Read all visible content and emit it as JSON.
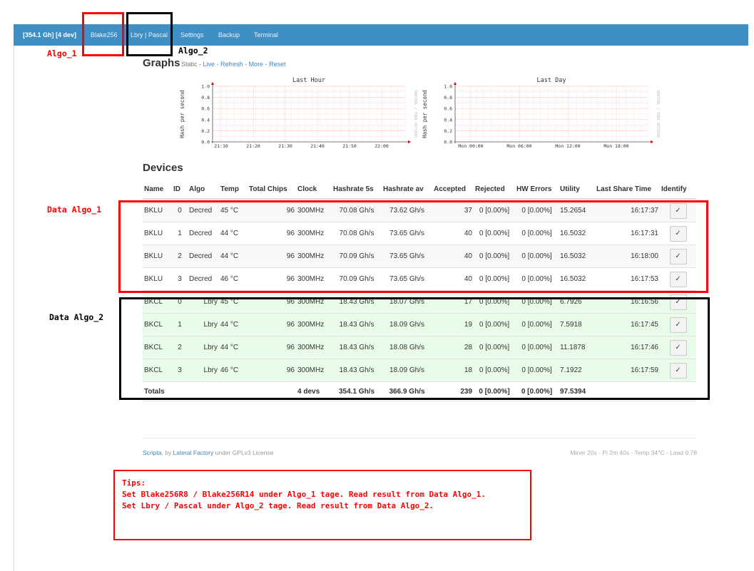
{
  "navbar": {
    "brand": "[354.1 Gh] [4 dev]",
    "items": [
      "Blake256",
      "Lbry | Pascal",
      "Settings",
      "Backup",
      "Terminal"
    ]
  },
  "annotations": {
    "algo1": "Algo_1",
    "algo2": "Algo_2",
    "data_algo1": "Data Algo_1",
    "data_algo2": "Data Algo_2"
  },
  "graphs": {
    "heading": "Graphs",
    "static_label": "Static -",
    "links": [
      "Live",
      "Refresh",
      "More",
      "Reset"
    ],
    "charts": [
      {
        "title": "Last Hour",
        "ylabel": "Hash per second",
        "right_label": "RRDTOOL / TOBI OETIKER",
        "yticks": [
          "1.0",
          "0.8",
          "0.6",
          "0.4",
          "0.2",
          "0.0"
        ],
        "xticks": [
          "21:10",
          "21:20",
          "21:30",
          "21:40",
          "21:50",
          "22:00"
        ]
      },
      {
        "title": "Last Day",
        "ylabel": "Hash per second",
        "right_label": "RRDTOOL / TOBI OETIKER",
        "yticks": [
          "1.0",
          "0.8",
          "0.6",
          "0.4",
          "0.2",
          "0.0"
        ],
        "xticks": [
          "Mon 00:00",
          "Mon 06:00",
          "Mon 12:00",
          "Mon 18:00"
        ]
      }
    ]
  },
  "devices": {
    "heading": "Devices",
    "columns": [
      "Name",
      "ID",
      "Algo",
      "Temp",
      "Total Chips",
      "Clock",
      "Hashrate 5s",
      "Hashrate av",
      "Accepted",
      "Rejected",
      "HW Errors",
      "Utility",
      "Last Share Time",
      "Identify"
    ],
    "identify_glyph": "✓",
    "rows": [
      {
        "group": "a1",
        "cells": [
          "BKLU",
          "0",
          "Decred",
          "45 °C",
          "96",
          "300MHz",
          "70.08 Gh/s",
          "73.62 Gh/s",
          "37",
          "0 [0.00%]",
          "0 [0.00%]",
          "15.2654",
          "16:17:37"
        ]
      },
      {
        "group": "a1",
        "cells": [
          "BKLU",
          "1",
          "Decred",
          "44 °C",
          "96",
          "300MHz",
          "70.08 Gh/s",
          "73.65 Gh/s",
          "40",
          "0 [0.00%]",
          "0 [0.00%]",
          "16.5032",
          "16:17:31"
        ]
      },
      {
        "group": "a1",
        "cells": [
          "BKLU",
          "2",
          "Decred",
          "44 °C",
          "96",
          "300MHz",
          "70.09 Gh/s",
          "73.65 Gh/s",
          "40",
          "0 [0.00%]",
          "0 [0.00%]",
          "16.5032",
          "16:18:00"
        ]
      },
      {
        "group": "a1",
        "cells": [
          "BKLU",
          "3",
          "Decred",
          "46 °C",
          "96",
          "300MHz",
          "70.09 Gh/s",
          "73.65 Gh/s",
          "40",
          "0 [0.00%]",
          "0 [0.00%]",
          "16.5032",
          "16:17:53"
        ]
      },
      {
        "group": "a2",
        "cells": [
          "BKCL",
          "0",
          "Lbry",
          "45 °C",
          "96",
          "300MHz",
          "18.43 Gh/s",
          "18.07 Gh/s",
          "17",
          "0 [0.00%]",
          "0 [0.00%]",
          "6.7926",
          "16:16:56"
        ]
      },
      {
        "group": "a2",
        "cells": [
          "BKCL",
          "1",
          "Lbry",
          "44 °C",
          "96",
          "300MHz",
          "18.43 Gh/s",
          "18.09 Gh/s",
          "19",
          "0 [0.00%]",
          "0 [0.00%]",
          "7.5918",
          "16:17:45"
        ]
      },
      {
        "group": "a2",
        "cells": [
          "BKCL",
          "2",
          "Lbry",
          "44 °C",
          "96",
          "300MHz",
          "18.43 Gh/s",
          "18.08 Gh/s",
          "28",
          "0 [0.00%]",
          "0 [0.00%]",
          "11.1878",
          "16:17:46"
        ]
      },
      {
        "group": "a2",
        "cells": [
          "BKCL",
          "3",
          "Lbry",
          "46 °C",
          "96",
          "300MHz",
          "18.43 Gh/s",
          "18.09 Gh/s",
          "18",
          "0 [0.00%]",
          "0 [0.00%]",
          "7.1922",
          "16:17:59"
        ]
      }
    ],
    "totals": {
      "label": "Totals",
      "clock": "4 devs",
      "hashrate_5s": "354.1 Gh/s",
      "hashrate_av": "366.9 Gh/s",
      "accepted": "239",
      "rejected": "0 [0.00%]",
      "hw_errors": "0 [0.00%]",
      "utility": "97.5394"
    }
  },
  "footer": {
    "scripta": "Scripta",
    "by": ", by ",
    "lateral": "Lateral Factory",
    "license": " under GPLv3 License",
    "right": "Miner 20s  -  Pi 2m 40s  -  Temp 34°C  -  Load 0.78"
  },
  "tips": {
    "title": "Tips:",
    "line1": "Set Blake256R8 / Blake256R14 under Algo_1 tage. Read result from Data Algo_1.",
    "line2": "Set Lbry / Pascal under Algo_2 tage. Read result from Data Algo_2."
  },
  "colors": {
    "navbar": "#3f8fc4",
    "annotation_red": "#ff0000",
    "link": "#3a87c8",
    "algo2_row": "#e9fbe9"
  }
}
